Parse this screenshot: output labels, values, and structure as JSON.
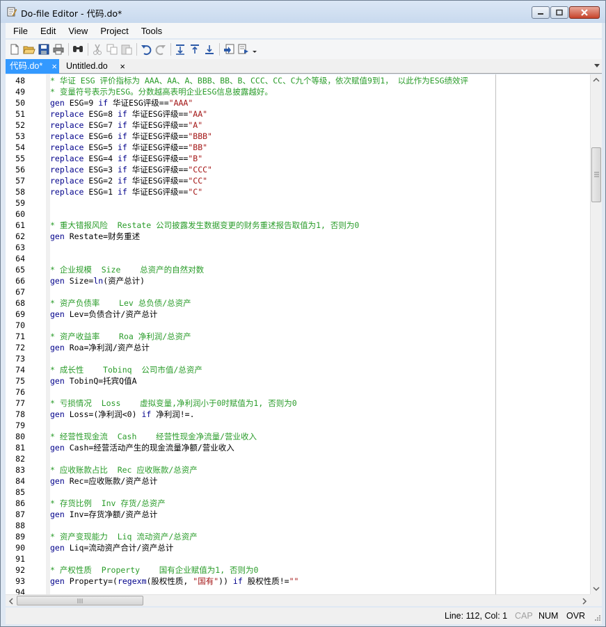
{
  "window": {
    "title": "Do-file Editor - 代码.do*"
  },
  "menu": [
    "File",
    "Edit",
    "View",
    "Project",
    "Tools"
  ],
  "tabs": [
    {
      "label": "代码.do*",
      "close": "×",
      "active": true
    },
    {
      "label": "Untitled.do",
      "close": "×",
      "active": false
    }
  ],
  "toolbar_icons": [
    "new-file-icon",
    "open-folder-icon",
    "save-icon",
    "print-icon",
    "find-icon",
    "cut-icon",
    "copy-icon",
    "paste-icon",
    "undo-icon",
    "redo-icon",
    "indent-icon",
    "shift-up-icon",
    "shift-down-icon",
    "bookmark-icon",
    "execute-icon"
  ],
  "lines": [
    {
      "n": "48",
      "parts": [
        [
          "cmt",
          "* 华证 ESG 评价指标为 AAA、AA、A、BBB、BB、B、CCC、CC、C九个等级，依次赋值9到1， 以此作为ESG绩效评"
        ]
      ]
    },
    {
      "n": "49",
      "parts": [
        [
          "cmt",
          "* 变量符号表示为ESG。分数越高表明企业ESG信息披露越好。"
        ]
      ]
    },
    {
      "n": "50",
      "parts": [
        [
          "kw",
          "gen"
        ],
        [
          "",
          " ESG=9 "
        ],
        [
          "kw",
          "if"
        ],
        [
          "",
          " 华证ESG评级=="
        ],
        [
          "str",
          "\"AAA\""
        ]
      ]
    },
    {
      "n": "51",
      "parts": [
        [
          "kw",
          "replace"
        ],
        [
          "",
          " ESG=8 "
        ],
        [
          "kw",
          "if"
        ],
        [
          "",
          " 华证ESG评级=="
        ],
        [
          "str",
          "\"AA\""
        ]
      ]
    },
    {
      "n": "52",
      "parts": [
        [
          "kw",
          "replace"
        ],
        [
          "",
          " ESG=7 "
        ],
        [
          "kw",
          "if"
        ],
        [
          "",
          " 华证ESG评级=="
        ],
        [
          "str",
          "\"A\""
        ]
      ]
    },
    {
      "n": "53",
      "parts": [
        [
          "kw",
          "replace"
        ],
        [
          "",
          " ESG=6 "
        ],
        [
          "kw",
          "if"
        ],
        [
          "",
          " 华证ESG评级=="
        ],
        [
          "str",
          "\"BBB\""
        ]
      ]
    },
    {
      "n": "54",
      "parts": [
        [
          "kw",
          "replace"
        ],
        [
          "",
          " ESG=5 "
        ],
        [
          "kw",
          "if"
        ],
        [
          "",
          " 华证ESG评级=="
        ],
        [
          "str",
          "\"BB\""
        ]
      ]
    },
    {
      "n": "55",
      "parts": [
        [
          "kw",
          "replace"
        ],
        [
          "",
          " ESG=4 "
        ],
        [
          "kw",
          "if"
        ],
        [
          "",
          " 华证ESG评级=="
        ],
        [
          "str",
          "\"B\""
        ]
      ]
    },
    {
      "n": "56",
      "parts": [
        [
          "kw",
          "replace"
        ],
        [
          "",
          " ESG=3 "
        ],
        [
          "kw",
          "if"
        ],
        [
          "",
          " 华证ESG评级=="
        ],
        [
          "str",
          "\"CCC\""
        ]
      ]
    },
    {
      "n": "57",
      "parts": [
        [
          "kw",
          "replace"
        ],
        [
          "",
          " ESG=2 "
        ],
        [
          "kw",
          "if"
        ],
        [
          "",
          " 华证ESG评级=="
        ],
        [
          "str",
          "\"CC\""
        ]
      ]
    },
    {
      "n": "58",
      "parts": [
        [
          "kw",
          "replace"
        ],
        [
          "",
          " ESG=1 "
        ],
        [
          "kw",
          "if"
        ],
        [
          "",
          " 华证ESG评级=="
        ],
        [
          "str",
          "\"C\""
        ]
      ]
    },
    {
      "n": "59",
      "parts": []
    },
    {
      "n": "60",
      "parts": []
    },
    {
      "n": "61",
      "parts": [
        [
          "cmt",
          "* 重大错报风险  Restate 公司披露发生数据变更的财务重述报告取值为1, 否则为0"
        ]
      ]
    },
    {
      "n": "62",
      "parts": [
        [
          "kw",
          "gen"
        ],
        [
          "",
          " Restate=财务重述"
        ]
      ]
    },
    {
      "n": "63",
      "parts": []
    },
    {
      "n": "64",
      "parts": []
    },
    {
      "n": "65",
      "parts": [
        [
          "cmt",
          "* 企业规模  Size    总资产的自然对数"
        ]
      ]
    },
    {
      "n": "66",
      "parts": [
        [
          "kw",
          "gen"
        ],
        [
          "",
          " Size="
        ],
        [
          "fn",
          "ln"
        ],
        [
          "",
          "(资产总计)"
        ]
      ]
    },
    {
      "n": "67",
      "parts": []
    },
    {
      "n": "68",
      "parts": [
        [
          "cmt",
          "* 资产负债率    Lev 总负债/总资产"
        ]
      ]
    },
    {
      "n": "69",
      "parts": [
        [
          "kw",
          "gen"
        ],
        [
          "",
          " Lev=负债合计/资产总计"
        ]
      ]
    },
    {
      "n": "70",
      "parts": []
    },
    {
      "n": "71",
      "parts": [
        [
          "cmt",
          "* 资产收益率    Roa 净利润/总资产"
        ]
      ]
    },
    {
      "n": "72",
      "parts": [
        [
          "kw",
          "gen"
        ],
        [
          "",
          " Roa=净利润/资产总计"
        ]
      ]
    },
    {
      "n": "73",
      "parts": []
    },
    {
      "n": "74",
      "parts": [
        [
          "cmt",
          "* 成长性    Tobinq  公司市值/总资产"
        ]
      ]
    },
    {
      "n": "75",
      "parts": [
        [
          "kw",
          "gen"
        ],
        [
          "",
          " TobinQ=托宾Q值A"
        ]
      ]
    },
    {
      "n": "76",
      "parts": []
    },
    {
      "n": "77",
      "parts": [
        [
          "cmt",
          "* 亏损情况  Loss    虚拟变量,净利润小于0时赋值为1, 否则为0"
        ]
      ]
    },
    {
      "n": "78",
      "parts": [
        [
          "kw",
          "gen"
        ],
        [
          "",
          " Loss=(净利润<0) "
        ],
        [
          "kw",
          "if"
        ],
        [
          "",
          " 净利润!=."
        ]
      ]
    },
    {
      "n": "79",
      "parts": []
    },
    {
      "n": "80",
      "parts": [
        [
          "cmt",
          "* 经营性现金流  Cash    经营性现金净流量/营业收入"
        ]
      ]
    },
    {
      "n": "81",
      "parts": [
        [
          "kw",
          "gen"
        ],
        [
          "",
          " Cash=经营活动产生的现金流量净额/营业收入"
        ]
      ]
    },
    {
      "n": "82",
      "parts": []
    },
    {
      "n": "83",
      "parts": [
        [
          "cmt",
          "* 应收账款占比  Rec 应收账款/总资产"
        ]
      ]
    },
    {
      "n": "84",
      "parts": [
        [
          "kw",
          "gen"
        ],
        [
          "",
          " Rec=应收账款/资产总计"
        ]
      ]
    },
    {
      "n": "85",
      "parts": []
    },
    {
      "n": "86",
      "parts": [
        [
          "cmt",
          "* 存货比例  Inv 存货/总资产"
        ]
      ]
    },
    {
      "n": "87",
      "parts": [
        [
          "kw",
          "gen"
        ],
        [
          "",
          " Inv=存货净额/资产总计"
        ]
      ]
    },
    {
      "n": "88",
      "parts": []
    },
    {
      "n": "89",
      "parts": [
        [
          "cmt",
          "* 资产变现能力  Liq 流动资产/总资产"
        ]
      ]
    },
    {
      "n": "90",
      "parts": [
        [
          "kw",
          "gen"
        ],
        [
          "",
          " Liq=流动资产合计/资产总计"
        ]
      ]
    },
    {
      "n": "91",
      "parts": []
    },
    {
      "n": "92",
      "parts": [
        [
          "cmt",
          "* 产权性质  Property    国有企业赋值为1, 否则为0"
        ]
      ]
    },
    {
      "n": "93",
      "parts": [
        [
          "kw",
          "gen"
        ],
        [
          "",
          " Property=("
        ],
        [
          "fn",
          "regexm"
        ],
        [
          "",
          "(股权性质, "
        ],
        [
          "str",
          "\"国有\""
        ],
        [
          "",
          ")) "
        ],
        [
          "kw",
          "if"
        ],
        [
          "",
          " 股权性质!="
        ],
        [
          "str",
          "\"\""
        ]
      ]
    },
    {
      "n": "94",
      "parts": []
    }
  ],
  "status": {
    "position": "Line: 112, Col: 1",
    "cap": "CAP",
    "num": "NUM",
    "ovr": "OVR"
  }
}
